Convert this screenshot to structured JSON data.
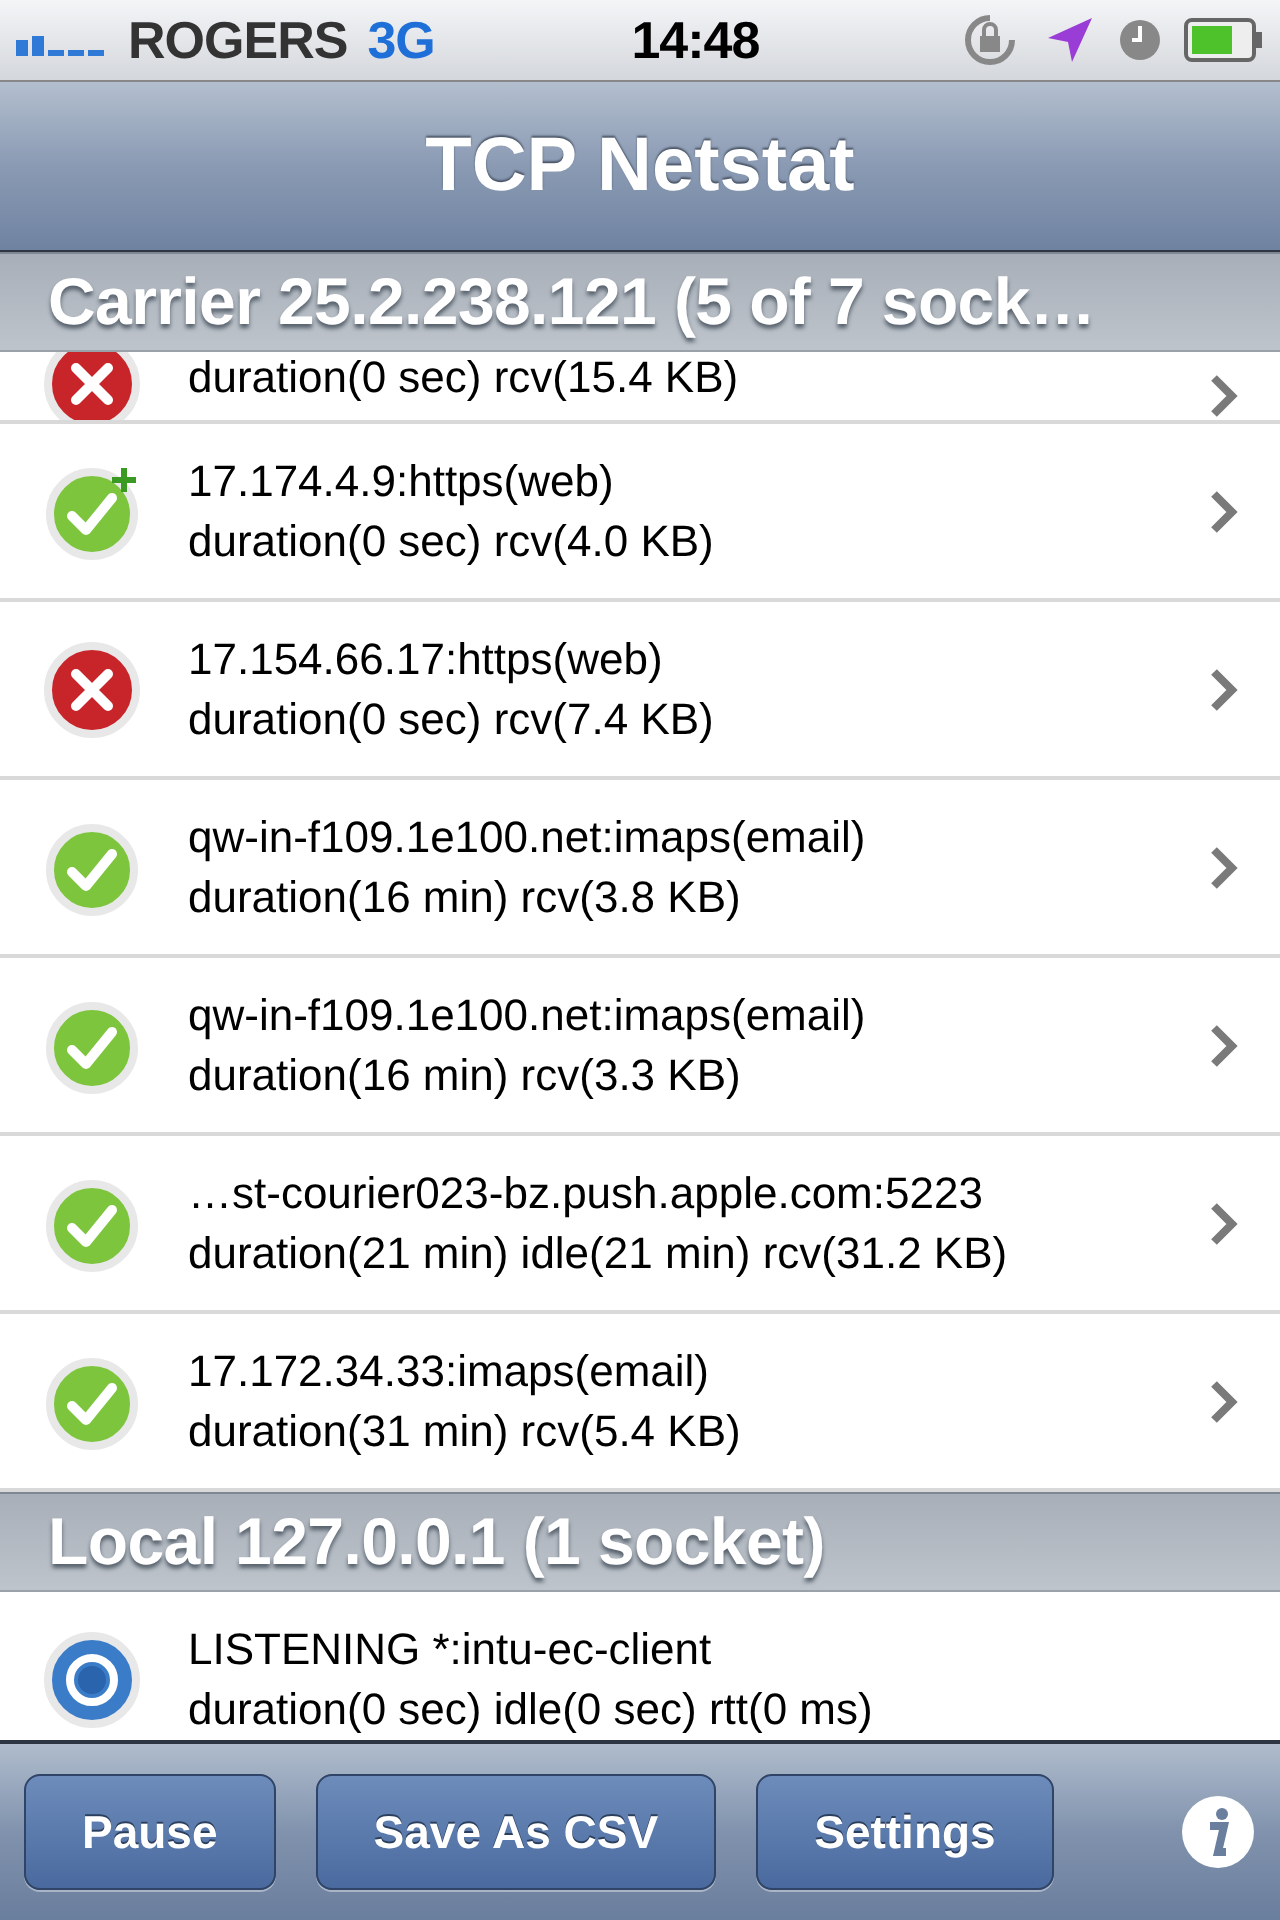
{
  "status_bar": {
    "carrier": "ROGERS",
    "network": "3G",
    "time": "14:48"
  },
  "nav_bar": {
    "title": "TCP Netstat"
  },
  "sections": [
    {
      "title": "Carrier 25.2.238.121 (5 of 7 sock…",
      "rows": [
        {
          "kind": "error",
          "partial": true,
          "detail": "duration(0 sec) rcv(15.4 KB)",
          "disclosure": true
        },
        {
          "kind": "new",
          "partial": false,
          "primary": "17.174.4.9:https(web)",
          "detail": "duration(0 sec) rcv(4.0 KB)",
          "disclosure": true
        },
        {
          "kind": "error",
          "partial": false,
          "primary": "17.154.66.17:https(web)",
          "detail": "duration(0 sec) rcv(7.4 KB)",
          "disclosure": true
        },
        {
          "kind": "ok",
          "partial": false,
          "primary": "qw-in-f109.1e100.net:imaps(email)",
          "detail": "duration(16 min) rcv(3.8 KB)",
          "disclosure": true
        },
        {
          "kind": "ok",
          "partial": false,
          "primary": "qw-in-f109.1e100.net:imaps(email)",
          "detail": "duration(16 min) rcv(3.3 KB)",
          "disclosure": true
        },
        {
          "kind": "ok",
          "partial": false,
          "primary": "…st-courier023-bz.push.apple.com:5223",
          "detail": "duration(21 min) idle(21 min) rcv(31.2 KB)",
          "disclosure": true
        },
        {
          "kind": "ok",
          "partial": false,
          "primary": "17.172.34.33:imaps(email)",
          "detail": "duration(31 min) rcv(5.4 KB)",
          "disclosure": true
        }
      ]
    },
    {
      "title": "Local 127.0.0.1 (1 socket)",
      "rows": [
        {
          "kind": "listening",
          "partial": false,
          "primary": "LISTENING *:intu-ec-client",
          "detail": "duration(0 sec) idle(0 sec) rtt(0 ms)",
          "disclosure": false
        }
      ]
    }
  ],
  "toolbar": {
    "buttons": [
      "Pause",
      "Save As CSV",
      "Settings"
    ]
  }
}
